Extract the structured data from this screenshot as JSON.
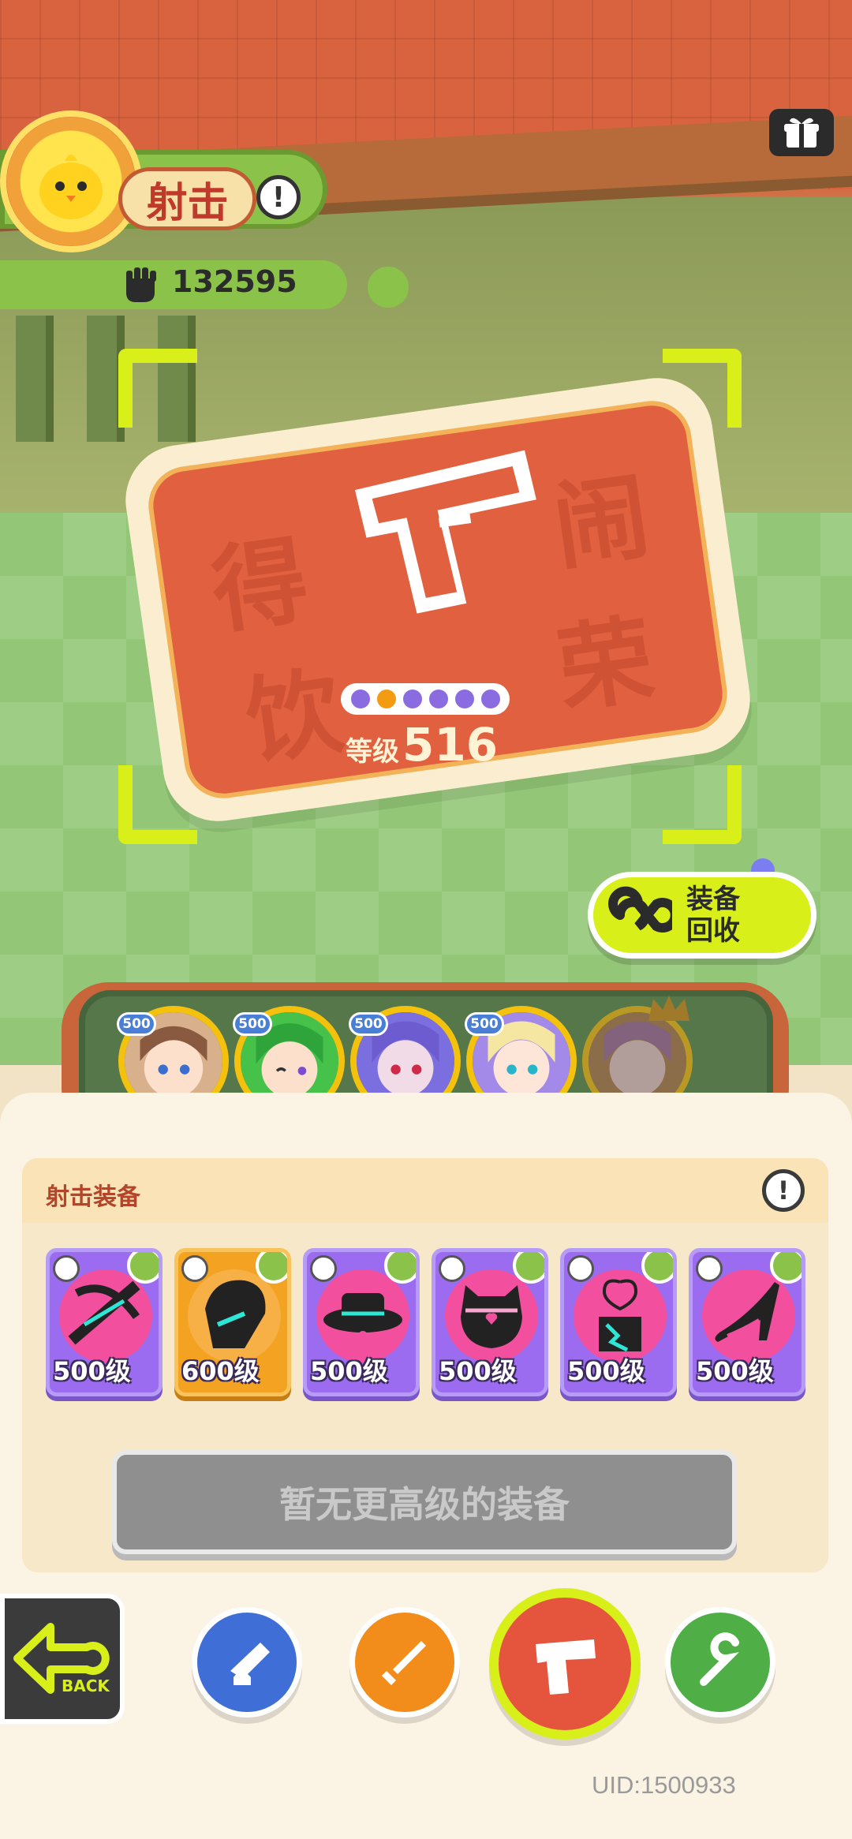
{
  "player": {
    "weapon_type": "射击",
    "power": "132595"
  },
  "weapon": {
    "level_prefix": "等级",
    "level_value": "516",
    "stars_total": 6,
    "stars_active_index": 1,
    "watermark": [
      "得",
      "闹",
      "饮",
      "荣"
    ]
  },
  "recycle": {
    "label": "装备回收"
  },
  "heroes": [
    {
      "badge": "500",
      "name": "hero-brown-hair"
    },
    {
      "badge": "500",
      "name": "hero-green-hair"
    },
    {
      "badge": "500",
      "name": "hero-purple-hair"
    },
    {
      "badge": "500",
      "name": "hero-blonde-hair"
    },
    {
      "badge": "",
      "name": "hero-locked"
    }
  ],
  "equipment_panel": {
    "title": "射击装备",
    "items": [
      {
        "level": "500级",
        "rarity": "purple",
        "icon": "crossbow-icon"
      },
      {
        "level": "600级",
        "rarity": "orange",
        "icon": "glove-icon"
      },
      {
        "level": "500级",
        "rarity": "purple",
        "icon": "hat-icon"
      },
      {
        "level": "500级",
        "rarity": "purple",
        "icon": "armor-icon"
      },
      {
        "level": "500级",
        "rarity": "purple",
        "icon": "amulet-icon"
      },
      {
        "level": "500级",
        "rarity": "purple",
        "icon": "heel-shoe-icon"
      }
    ],
    "status_button": "暂无更高级的装备"
  },
  "nav": {
    "back": "BACK",
    "items": [
      "cannon-icon",
      "sword-icon",
      "gun-icon",
      "staff-icon"
    ],
    "active": "gun-icon"
  },
  "uid": "UID:1500933",
  "colors": {
    "accent_lime": "#d8ef1a",
    "card_red": "#e0603f",
    "purple_rarity": "#9c6cf0",
    "orange_rarity": "#f3a221"
  }
}
